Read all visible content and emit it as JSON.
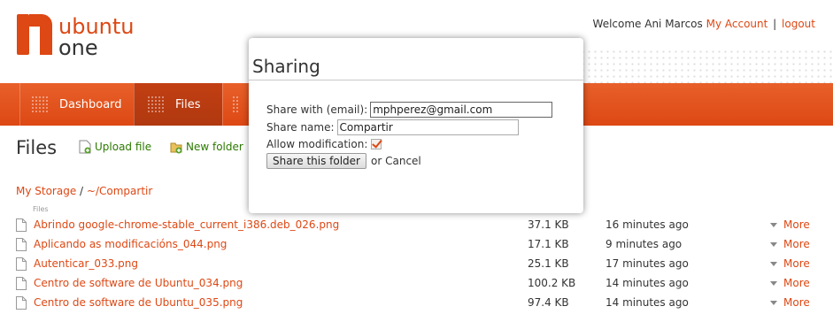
{
  "header": {
    "logo_alt": "ubuntu one",
    "welcome": "Welcome Ani Marcos",
    "my_account": "My Account",
    "separator": "|",
    "logout": "logout"
  },
  "nav": {
    "dashboard": "Dashboard",
    "files": "Files"
  },
  "files_header": {
    "title": "Files",
    "upload": "Upload file",
    "new_folder": "New folder"
  },
  "breadcrumb": {
    "root": "My Storage",
    "sep": " / ",
    "current": "~/Compartir"
  },
  "table": {
    "col_files": "Files",
    "rows": [
      {
        "name": "Abrindo google-chrome-stable_current_i386.deb_026.png",
        "size": "37.1 KB",
        "time": "16 minutes ago",
        "more": "More"
      },
      {
        "name": "Aplicando as modificacións_044.png",
        "size": "17.1 KB",
        "time": "9 minutes ago",
        "more": "More"
      },
      {
        "name": "Autenticar_033.png",
        "size": "25.1 KB",
        "time": "17 minutes ago",
        "more": "More"
      },
      {
        "name": "Centro de software de Ubuntu_034.png",
        "size": "100.2 KB",
        "time": "14 minutes ago",
        "more": "More"
      },
      {
        "name": "Centro de software de Ubuntu_035.png",
        "size": "97.4 KB",
        "time": "14 minutes ago",
        "more": "More"
      }
    ]
  },
  "modal": {
    "title": "Sharing",
    "share_with_label": "Share with (email):",
    "share_with_value": "mphperez@gmail.com",
    "share_name_label": "Share name:",
    "share_name_value": "Compartir",
    "allow_mod_label": "Allow modification:",
    "allow_mod_checked": true,
    "share_button": "Share this folder",
    "or_text": "or",
    "cancel": "Cancel"
  },
  "colors": {
    "accent": "#dd4814",
    "nav_active": "#b0380f"
  }
}
